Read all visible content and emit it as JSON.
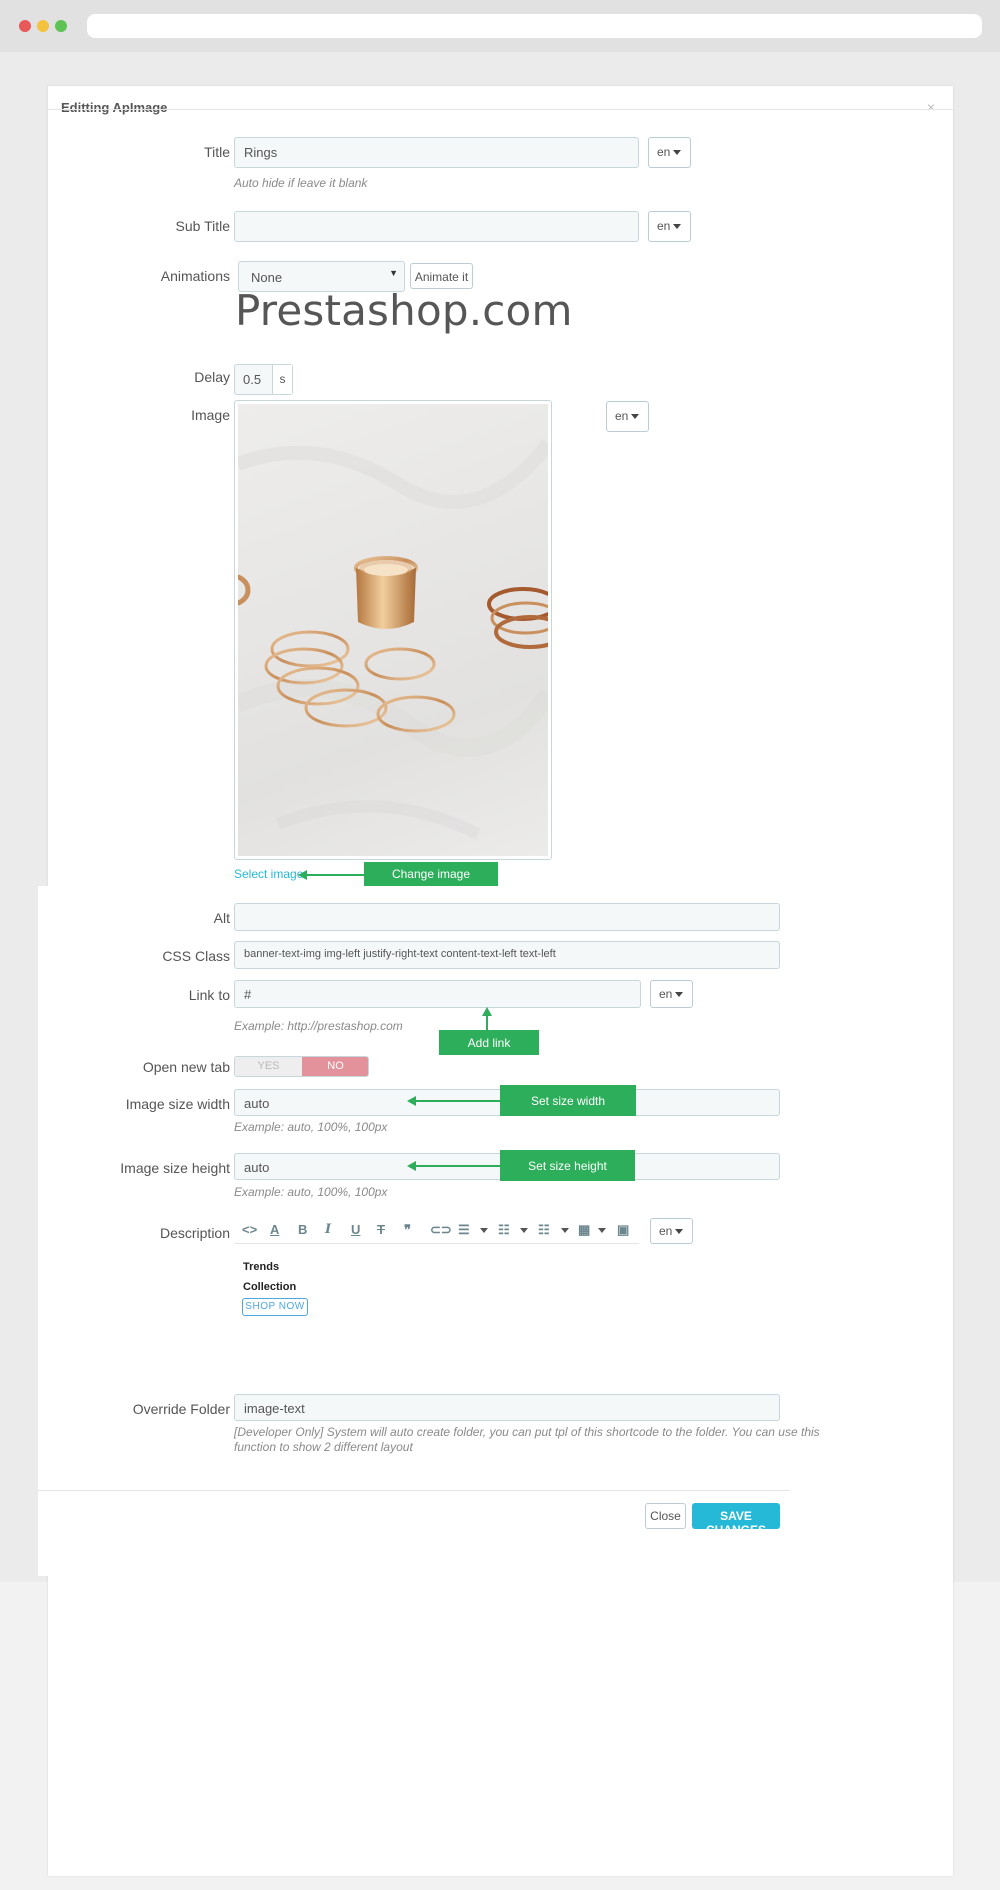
{
  "modal": {
    "title": "Editting ApImage",
    "close_glyph": "×"
  },
  "fields": {
    "title": {
      "label": "Title",
      "value": "Rings",
      "lang": "en",
      "help": "Auto hide if leave it blank"
    },
    "subtitle": {
      "label": "Sub Title",
      "value": "",
      "lang": "en"
    },
    "animations": {
      "label": "Animations",
      "selected": "None",
      "button": "Animate it",
      "preview_text": "Prestashop.com"
    },
    "delay": {
      "label": "Delay",
      "value": "0.5",
      "unit": "s"
    },
    "image": {
      "label": "Image",
      "lang": "en",
      "select_link": "Select image"
    },
    "alt": {
      "label": "Alt",
      "value": ""
    },
    "css_class": {
      "label": "CSS Class",
      "value": "banner-text-img img-left justify-right-text content-text-left text-left"
    },
    "link_to": {
      "label": "Link to",
      "value": "#",
      "lang": "en",
      "help": "Example: http://prestashop.com"
    },
    "open_new_tab": {
      "label": "Open new tab",
      "yes": "YES",
      "no": "NO",
      "selected": "NO"
    },
    "image_width": {
      "label": "Image size width",
      "value": "auto",
      "help": "Example: auto, 100%, 100px"
    },
    "image_height": {
      "label": "Image size height",
      "value": "auto",
      "help": "Example: auto, 100%, 100px"
    },
    "description": {
      "label": "Description",
      "lang": "en",
      "line1": "Trends",
      "line2": "Collection",
      "button": "SHOP NOW"
    },
    "override_folder": {
      "label": "Override Folder",
      "value": "image-text",
      "help_line1": "[Developer Only] System will auto create folder, you can put tpl of this shortcode to the folder. You can use this",
      "help_line2": "function to show 2 different layout"
    }
  },
  "annotations": {
    "change_image": "Change image",
    "add_link": "Add link",
    "set_width": "Set size width",
    "set_height": "Set size height"
  },
  "footer": {
    "close": "Close",
    "save": "SAVE CHANGES"
  },
  "colors": {
    "accent": "#25b9d7",
    "annotation_green": "#2dae5b",
    "toggle_no": "#e3919a"
  },
  "toolbar_icons": [
    "code-icon",
    "text-color-icon",
    "bold-icon",
    "italic-icon",
    "underline-icon",
    "strikethrough-icon",
    "quote-icon",
    "link-icon",
    "align-icon",
    "unordered-list-icon",
    "ordered-list-icon",
    "table-icon",
    "image-icon"
  ]
}
